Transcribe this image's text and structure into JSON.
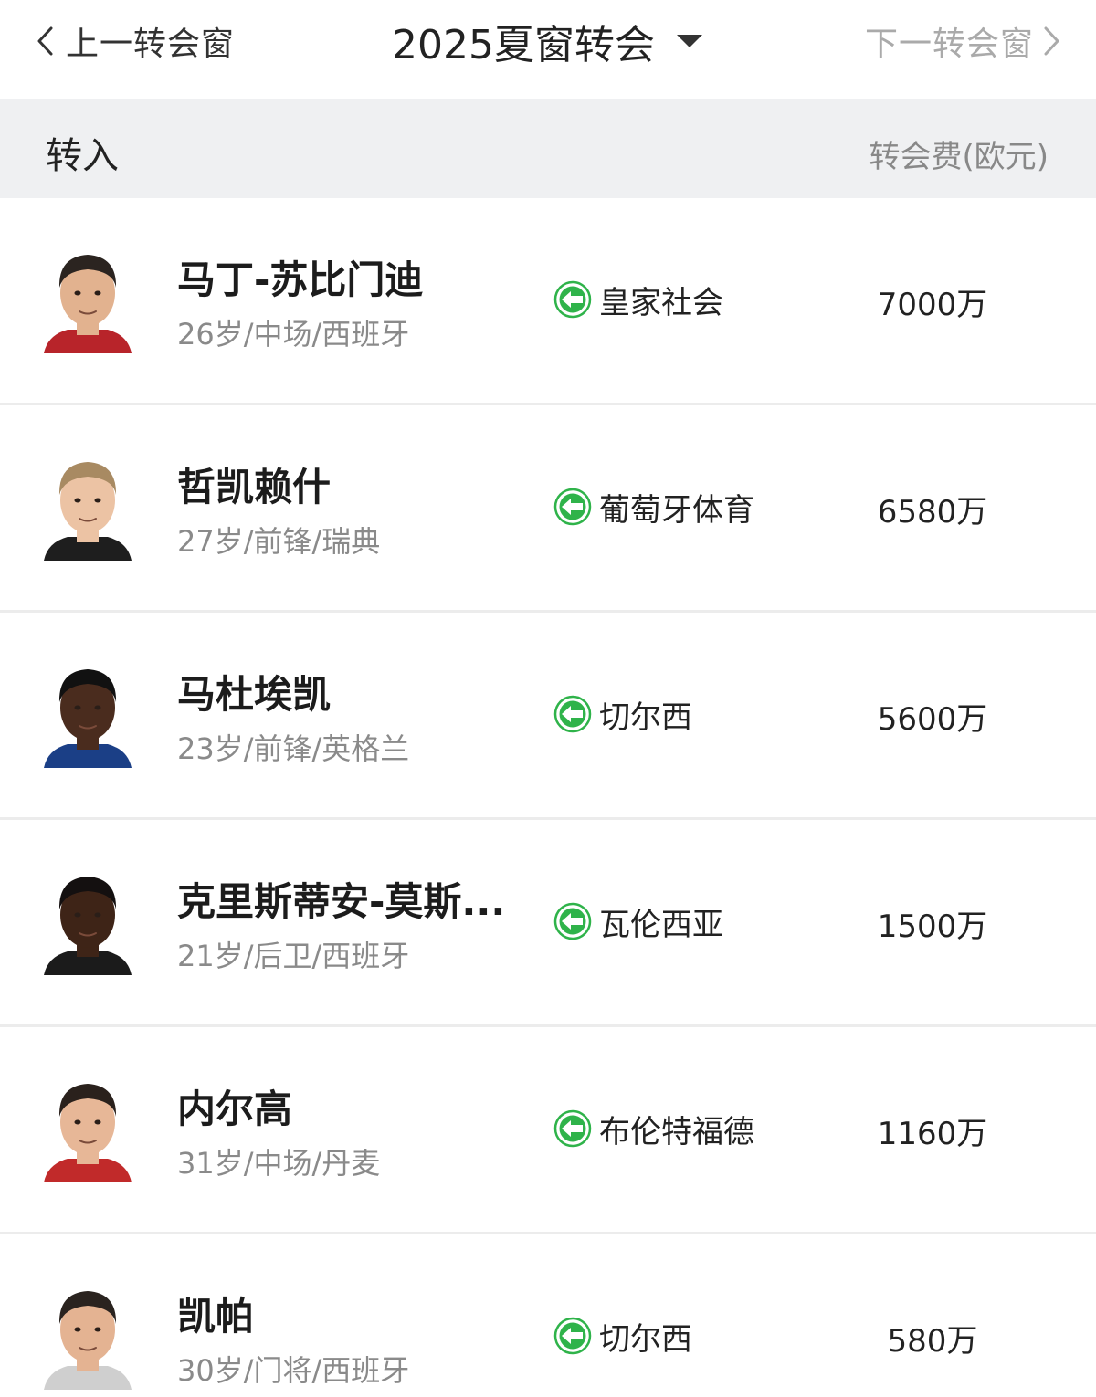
{
  "nav": {
    "prev_label": "上一转会窗",
    "title": "2025夏窗转会",
    "next_label": "下一转会窗"
  },
  "header": {
    "left": "转入",
    "right": "转会费(欧元)"
  },
  "players": [
    {
      "name": "马丁-苏比门迪",
      "info": "26岁/中场/西班牙",
      "club": "皇家社会",
      "fee": "7000万",
      "skin": "#e2b28f",
      "hair": "#2b2420",
      "shirt": "#b8242a"
    },
    {
      "name": "哲凯赖什",
      "info": "27岁/前锋/瑞典",
      "club": "葡萄牙体育",
      "fee": "6580万",
      "skin": "#ecc3a4",
      "hair": "#a88a62",
      "shirt": "#1e1e1e"
    },
    {
      "name": "马杜埃凯",
      "info": "23岁/前锋/英格兰",
      "club": "切尔西",
      "fee": "5600万",
      "skin": "#4a2c1e",
      "hair": "#111111",
      "shirt": "#1b3f86"
    },
    {
      "name": "克里斯蒂安-莫斯...",
      "info": "21岁/后卫/西班牙",
      "club": "瓦伦西亚",
      "fee": "1500万",
      "skin": "#3e2417",
      "hair": "#141010",
      "shirt": "#1b1b1b"
    },
    {
      "name": "内尔高",
      "info": "31岁/中场/丹麦",
      "club": "布伦特福德",
      "fee": "1160万",
      "skin": "#e7b797",
      "hair": "#2a211c",
      "shirt": "#c12a2a"
    },
    {
      "name": "凯帕",
      "info": "30岁/门将/西班牙",
      "club": "切尔西",
      "fee": "580万",
      "skin": "#e4b392",
      "hair": "#2a231f",
      "shirt": "#cfcfcf"
    }
  ],
  "colors": {
    "accent_green": "#2fb34a",
    "header_bg": "#eff0f2",
    "muted_text": "#8a8a8a"
  },
  "icons": {
    "prev": "chevron-left-icon",
    "dropdown": "caret-down-icon",
    "next": "chevron-right-icon",
    "incoming": "incoming-arrow-icon"
  }
}
